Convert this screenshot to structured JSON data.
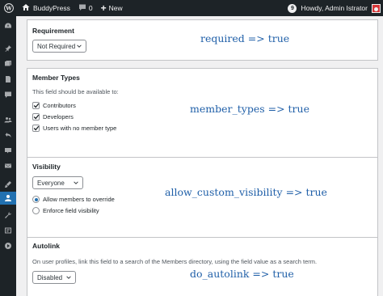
{
  "adminbar": {
    "site_name": "BuddyPress",
    "comments_count": "0",
    "new_label": "New",
    "notifications_count": "9",
    "howdy": "Howdy, Admin Istrator"
  },
  "cards": {
    "requirement": {
      "title": "Requirement",
      "select_value": "Not Required",
      "note": "required => true"
    },
    "member_types": {
      "title": "Member Types",
      "description": "This field should be available to:",
      "options": [
        "Contributors",
        "Developers",
        "Users with no member type"
      ],
      "checked": [
        true,
        true,
        true
      ],
      "note": "member_types => true"
    },
    "visibility": {
      "title": "Visibility",
      "select_value": "Everyone",
      "radios": [
        "Allow members to override",
        "Enforce field visibility"
      ],
      "selected_radio": 0,
      "note": "allow_custom_visibility => true"
    },
    "autolink": {
      "title": "Autolink",
      "description": "On user profiles, link this field to a search of the Members directory, using the field value as a search term.",
      "select_value": "Disabled",
      "note": "do_autolink => true"
    }
  },
  "sidebar_icons": [
    "dashboard-icon",
    "pin-icon",
    "media-icon",
    "pages-icon",
    "comments-icon",
    "buddypress-icon",
    "activity-icon",
    "woo-icon",
    "mail-icon",
    "appearance-icon",
    "plugins-icon",
    "users-icon",
    "tools-icon",
    "settings-icon",
    "play-icon"
  ],
  "colors": {
    "adminbar_bg": "#1d2327",
    "accent": "#2271b1",
    "note_text": "#1f5fa8"
  }
}
